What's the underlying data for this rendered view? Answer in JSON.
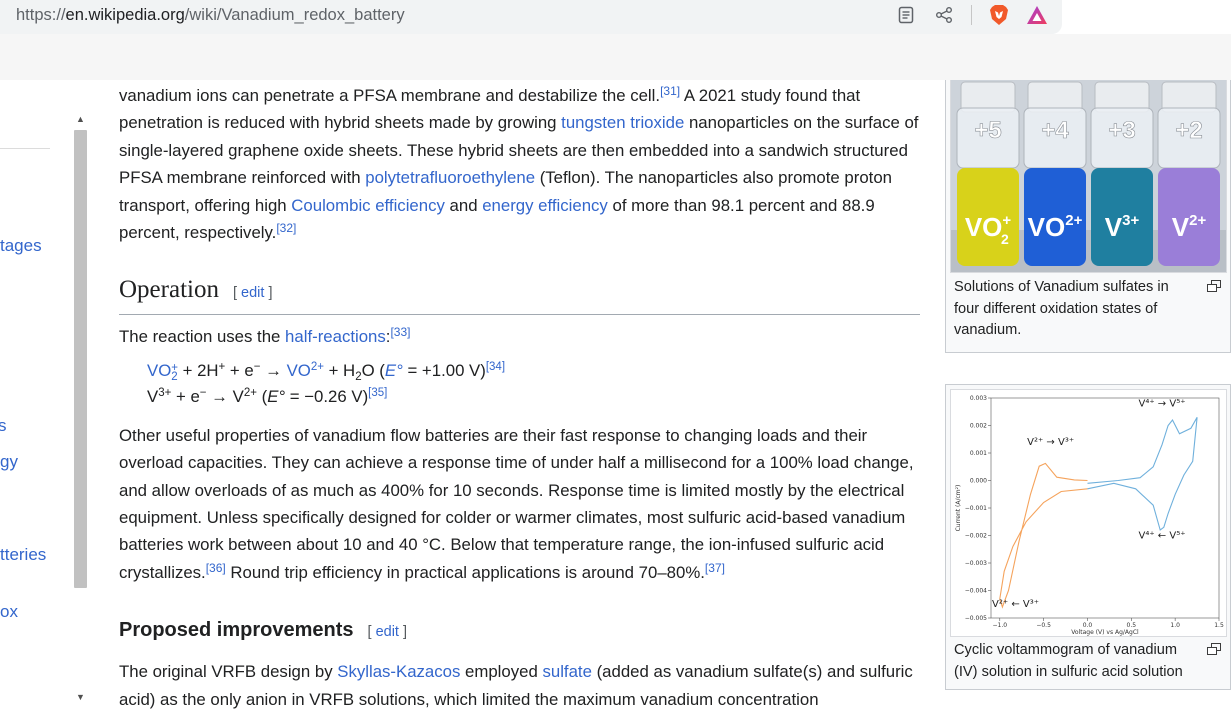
{
  "browser": {
    "url_prefix": "https://",
    "url_host": "en.wikipedia.org",
    "url_path": "/wiki/Vanadium_redox_battery",
    "icons": [
      "reader-mode-icon",
      "share-icon",
      "brave-shields-icon",
      "brave-rewards-icon"
    ]
  },
  "sidebar": {
    "fragments": [
      "tages",
      "s",
      "gy",
      "tteries",
      "ox"
    ]
  },
  "intro": {
    "t1": "vanadium ions can penetrate a PFSA membrane and destabilize the cell.",
    "ref31": "[31]",
    "t2": " A 2021 study found that penetration is reduced with hybrid sheets made by growing ",
    "link_tungsten": "tungsten trioxide",
    "t3": " nanoparticles on the surface of single-layered graphene oxide sheets. These hybrid sheets are then embedded into a sandwich structured PFSA membrane reinforced with ",
    "link_ptfe": "polytetrafluoroethylene",
    "t4": " (Teflon). The nanoparticles also promote proton transport, offering high ",
    "link_coulombic": "Coulombic efficiency",
    "t5": " and ",
    "link_energy": "energy efficiency",
    "t6": " of more than 98.1 percent and 88.9 percent, respectively.",
    "ref32": "[32]"
  },
  "operation": {
    "heading": "Operation",
    "edit_open": "[ ",
    "edit_label": "edit",
    "edit_close": " ]",
    "lead": "The reaction uses the ",
    "link_half": "half-reactions",
    "colon": ":",
    "ref33": "[33]",
    "f1_vo2": "VO",
    "f1_plus": "+",
    "f1_two": "2",
    "f1_mid": " + 2H",
    "f1_hplus": "+",
    "f1_e": " + e",
    "f1_eminus": "−",
    "f1_arrow": " → ",
    "f1_vo": "VO",
    "f1_vo_charge": "2+",
    "f1_h2o_a": " + H",
    "f1_h2o_sub": "2",
    "f1_h2o_b": "O (",
    "f1_E": "E°",
    "f1_val": " = +1.00 V)",
    "ref34": "[34]",
    "f2_v": "V",
    "f2_v_charge": "3+",
    "f2_e": " + e",
    "f2_eminus": "−",
    "f2_arrow": " → V",
    "f2_charge2": "2+",
    "f2_open": " (",
    "f2_E": "E°",
    "f2_val": " = −0.26 V)",
    "ref35": "[35]",
    "p2a": "Other useful properties of vanadium flow batteries are their fast response to changing loads and their overload capacities. They can achieve a response time of under half a millisecond for a 100% load change, and allow overloads of as much as 400% for 10 seconds. Response time is limited mostly by the electrical equipment. Unless specifically designed for colder or warmer climates, most sulfuric acid-based vanadium batteries work between about 10 and 40 °C. Below that temperature range, the ion-infused sulfuric acid crystallizes.",
    "ref36": "[36]",
    "p2b": " Round trip efficiency in practical applications is around 70–80%.",
    "ref37": "[37]"
  },
  "improvements": {
    "heading": "Proposed improvements",
    "edit_open": "[ ",
    "edit_label": "edit",
    "edit_close": " ]",
    "t1": "The original VRFB design by ",
    "link_skyllas": "Skyllas-Kazacos",
    "t2": " employed ",
    "link_sulfate": "sulfate",
    "t3": " (added as vanadium sulfate(s) and sulfuric acid) as the only anion in VRFB solutions, which limited the maximum vanadium concentration"
  },
  "figure1": {
    "caption": "Solutions of Vanadium sulfates in four different oxidation states of vanadium.",
    "top_labels": [
      "+5",
      "+4",
      "+3",
      "+2"
    ],
    "ion_labels": [
      "VO2+",
      "VO2+",
      "V3+",
      "V2+"
    ],
    "colors": [
      "#d8d21a",
      "#1f5fd6",
      "#1f7fa0",
      "#9a7ed8"
    ]
  },
  "figure2": {
    "caption": "Cyclic voltammogram of vanadium (IV) solution in sulfuric acid solution",
    "ylabel": "Current (A/cm²)",
    "xlabel": "Voltage (V) vs Ag/AgCl",
    "yticks": [
      "0.003",
      "0.002",
      "0.001",
      "0.000",
      "−0.001",
      "−0.002",
      "−0.003",
      "−0.004",
      "−0.005"
    ],
    "xticks": [
      "−1.0",
      "−0.5",
      "0.0",
      "0.5",
      "1.0",
      "1.5"
    ],
    "ann_v2v3": "V²⁺ → V³⁺",
    "ann_v4v5": "V⁴⁺ → V⁵⁺",
    "ann_v4v5_rev": "V⁴⁺ ← V⁵⁺",
    "ann_v2v3_rev": "V²⁺ ← V³⁺",
    "colors": {
      "negative": "#f5a35c",
      "positive": "#6fb0dc"
    }
  }
}
